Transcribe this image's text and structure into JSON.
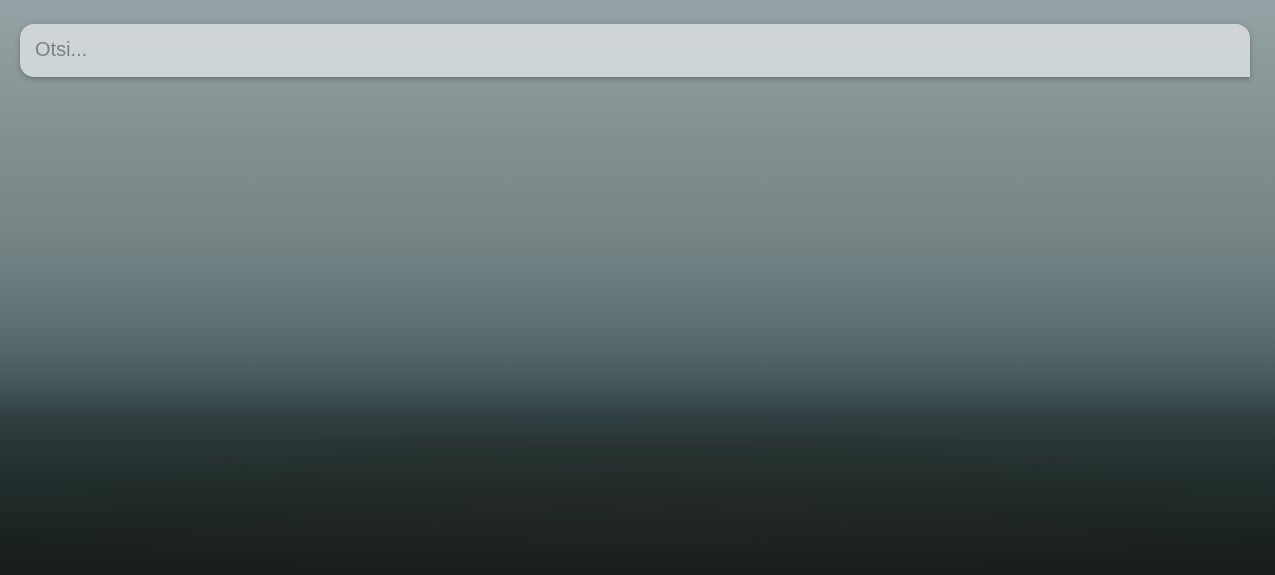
{
  "search": {
    "placeholder": "Otsi...",
    "value": ""
  },
  "colors": {
    "sky_top": "#96a3a6",
    "fog_mid": "#798788",
    "horizon": "#324245",
    "ground": "#171d1b",
    "search_background": "#d7ddde"
  }
}
